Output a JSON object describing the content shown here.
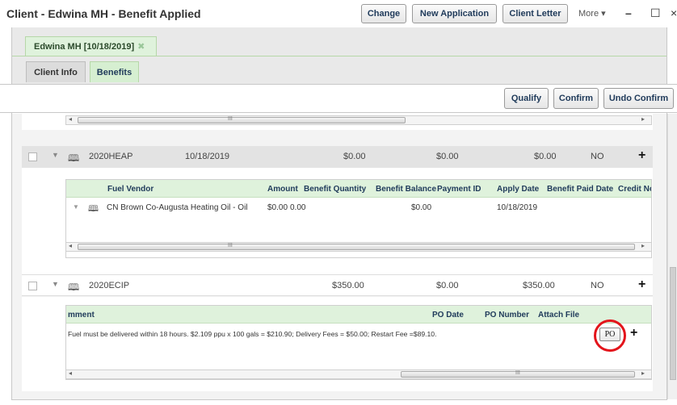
{
  "window": {
    "title": "Client - Edwina MH - Benefit Applied",
    "buttons": {
      "change": "Change",
      "new_application": "New Application",
      "client_letter": "Client Letter"
    },
    "more": "More ▾",
    "minimize": "–",
    "maximize": "☐",
    "close": "×"
  },
  "client_tab": {
    "label": "Edwina MH [10/18/2019]",
    "close_glyph": "✖"
  },
  "subtabs": {
    "client_info": "Client Info",
    "benefits": "Benefits"
  },
  "actions": {
    "qualify": "Qualify",
    "confirm": "Confirm",
    "undo_confirm": "Undo Confirm"
  },
  "benefit_rows": [
    {
      "name": "2020HEAP",
      "date": "10/18/2019",
      "amount": "$0.00",
      "balance": "$0.00",
      "paid": "$0.00",
      "flag": "NO",
      "plus": "+"
    },
    {
      "name": "2020ECIP",
      "date": "",
      "amount": "$350.00",
      "balance": "$0.00",
      "paid": "$350.00",
      "flag": "NO",
      "plus": "+"
    }
  ],
  "heap_grid": {
    "columns": [
      "Fuel Vendor",
      "Amount",
      "Benefit Quantity",
      "Benefit Balance",
      "Payment ID",
      "Apply Date",
      "Benefit Paid Date",
      "Credit No"
    ],
    "row": {
      "vendor": "CN Brown Co-Augusta Heating Oil - Oil",
      "amount": "$0.00",
      "quantity": "0.00",
      "balance": "$0.00",
      "payment_id": "",
      "apply_date": "10/18/2019"
    }
  },
  "ecip_grid": {
    "columns": [
      "mment",
      "PO Date",
      "PO Number",
      "Attach File"
    ],
    "row": {
      "comment": "Fuel must be delivered within 18 hours. $2.109 ppu x 100 gals = $210.90; Delivery Fees = $50.00; Restart Fee =$89.10.",
      "po_button": "PO",
      "plus": "+"
    }
  },
  "scroll_glyphs": {
    "left": "◂",
    "right": "▸",
    "grip": "III"
  },
  "icons": {
    "caret": "▼",
    "book": "🕮"
  },
  "colors": {
    "tab_green": "#dff2dc",
    "header_green": "#dff2dc",
    "highlight_ring": "#e3141b"
  }
}
